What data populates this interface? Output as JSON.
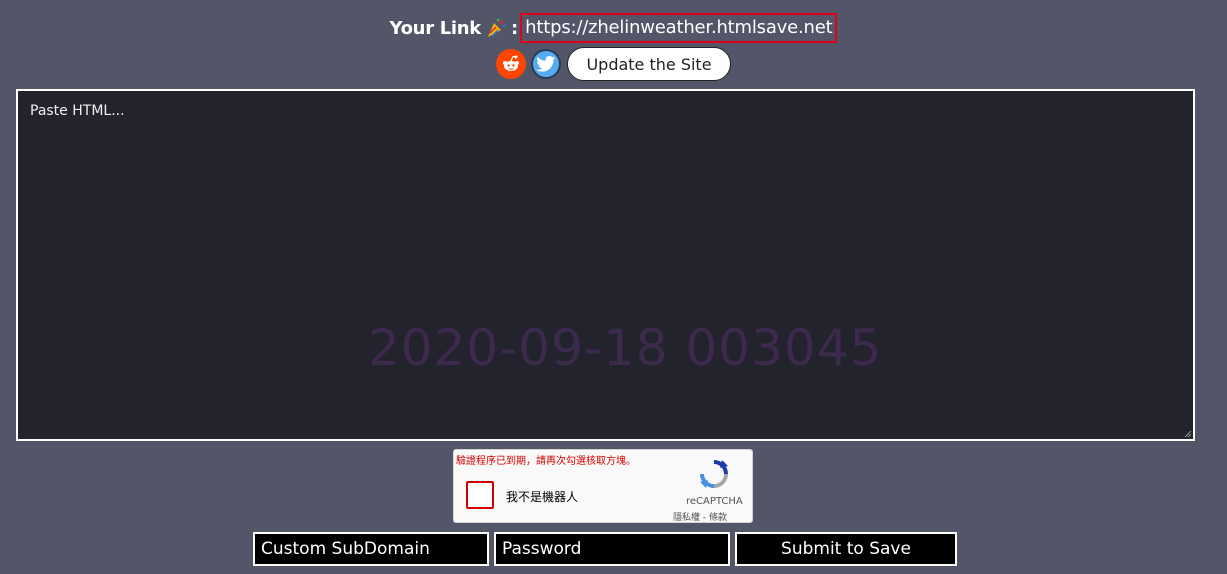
{
  "header": {
    "link_label": "Your Link",
    "colon": ":",
    "link_url": "https://zhelinweather.htmlsave.net"
  },
  "actions": {
    "update_label": "Update the Site"
  },
  "editor": {
    "placeholder": "Paste HTML...",
    "watermark": "2020-09-18  003045"
  },
  "captcha": {
    "error": "驗證程序已到期，請再次勾選核取方塊。",
    "label": "我不是機器人",
    "brand": "reCAPTCHA",
    "links": "隱私權 - 條款"
  },
  "form": {
    "subdomain_placeholder": "Custom SubDomain",
    "password_placeholder": "Password",
    "submit_label": "Submit to Save"
  }
}
